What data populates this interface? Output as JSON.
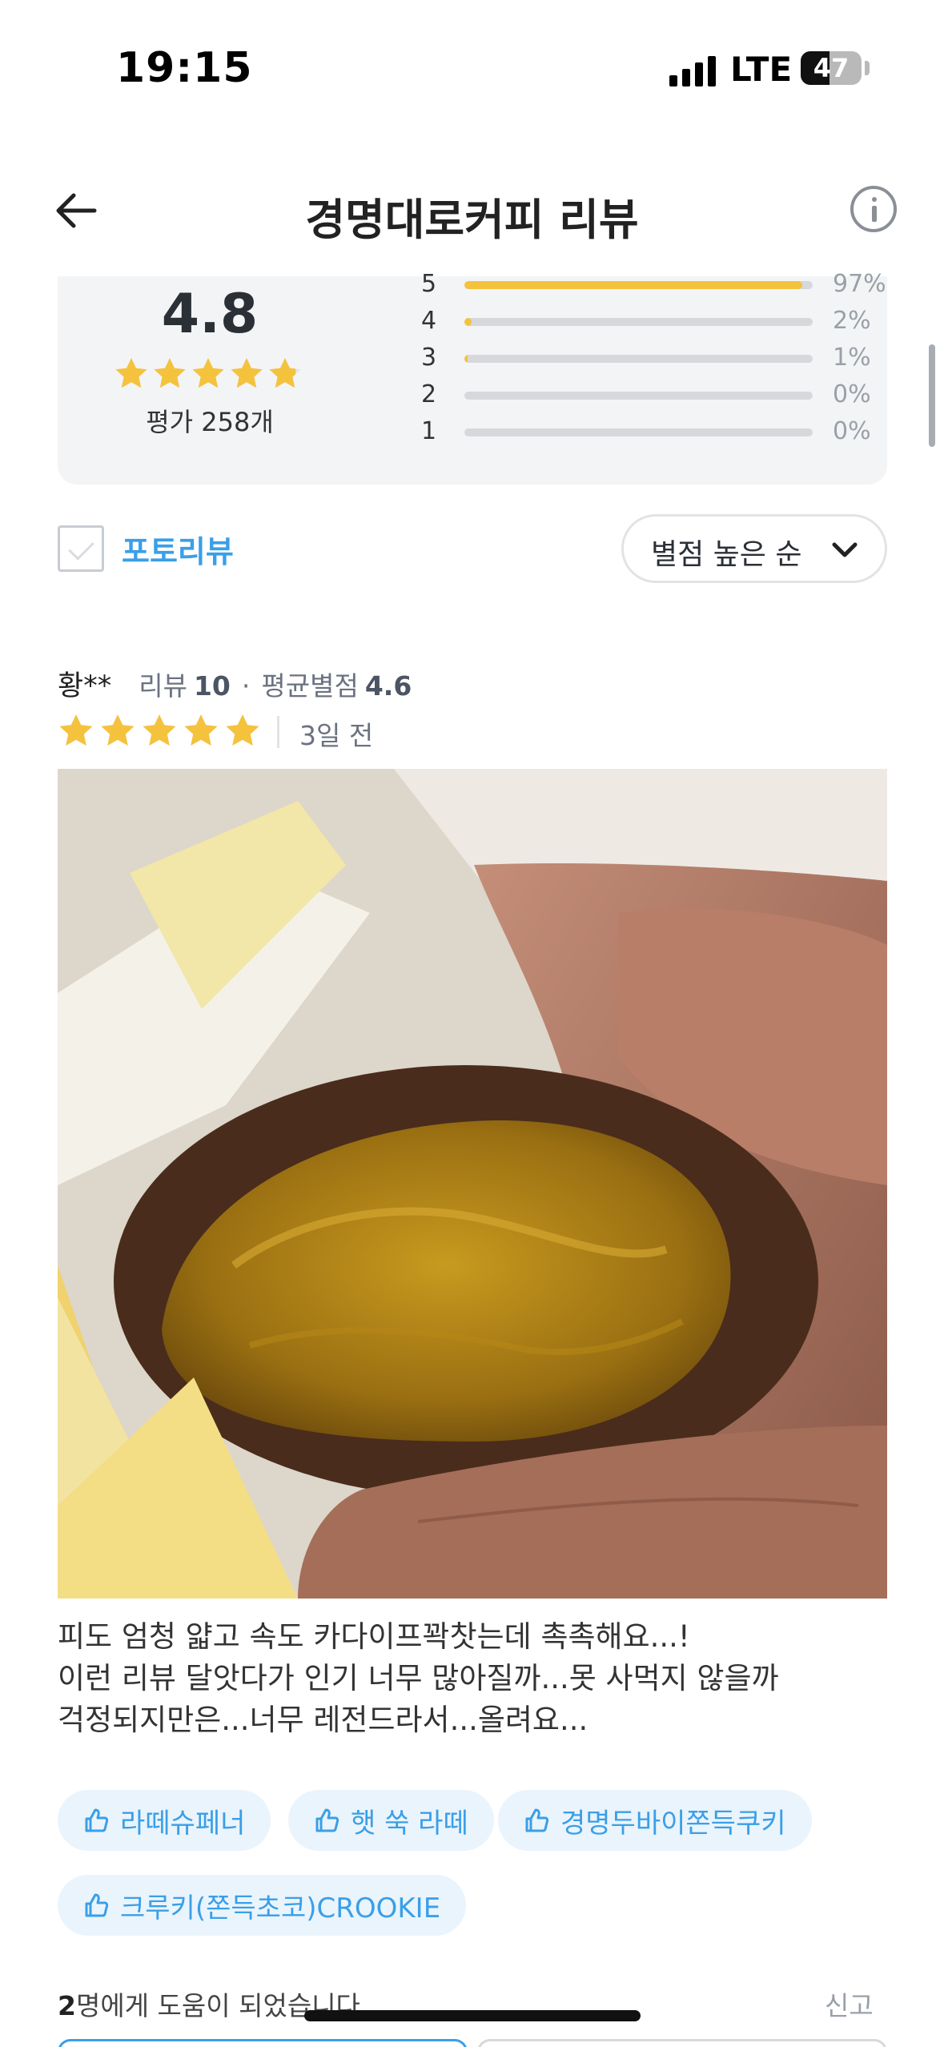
{
  "status_bar": {
    "time": "19:15",
    "network": "LTE",
    "battery": "47",
    "battery_level": 0.47
  },
  "header": {
    "title": "경명대로커피 리뷰",
    "back_icon": "arrow-left-icon",
    "info_icon": "info-icon"
  },
  "rating_summary": {
    "average": "4.8",
    "stars": 4.8,
    "total": "평가 258개",
    "distribution": [
      {
        "score": "5",
        "percent_label": "97%",
        "percent": 97
      },
      {
        "score": "4",
        "percent_label": "2%",
        "percent": 2
      },
      {
        "score": "3",
        "percent_label": "1%",
        "percent": 1
      },
      {
        "score": "2",
        "percent_label": "0%",
        "percent": 0
      },
      {
        "score": "1",
        "percent_label": "0%",
        "percent": 0
      }
    ]
  },
  "filters": {
    "photo_review_label": "포토리뷰",
    "photo_review_checked": false,
    "sort_label": "별점 높은 순"
  },
  "review": {
    "author": "황**",
    "review_count_label": "리뷰",
    "review_count": "10",
    "avg_label": "평균별점",
    "avg_value": "4.6",
    "rating": 5,
    "date": "3일 전",
    "text_lines": [
      "피도 엄청 얇고 속도 카다이프꽉찻는데 촉촉해요...!",
      "이런 리뷰 달앗다가 인기 너무 많아질까...못 사먹지 않을까",
      "걱정되지만은...너무 레전드라서...올려요..."
    ],
    "tags": [
      "라떼슈페너",
      "햇 쑥 라떼",
      "경명두바이쫀득쿠키",
      "크루키(쫀득초코)CROOKIE"
    ],
    "helpful_count": "2",
    "helpful_suffix": "명에게 도움이 되었습니다",
    "report_label": "신고"
  },
  "colors": {
    "accent": "#3a9fe8",
    "star": "#f5c23e",
    "card_bg": "#f3f4f6"
  }
}
